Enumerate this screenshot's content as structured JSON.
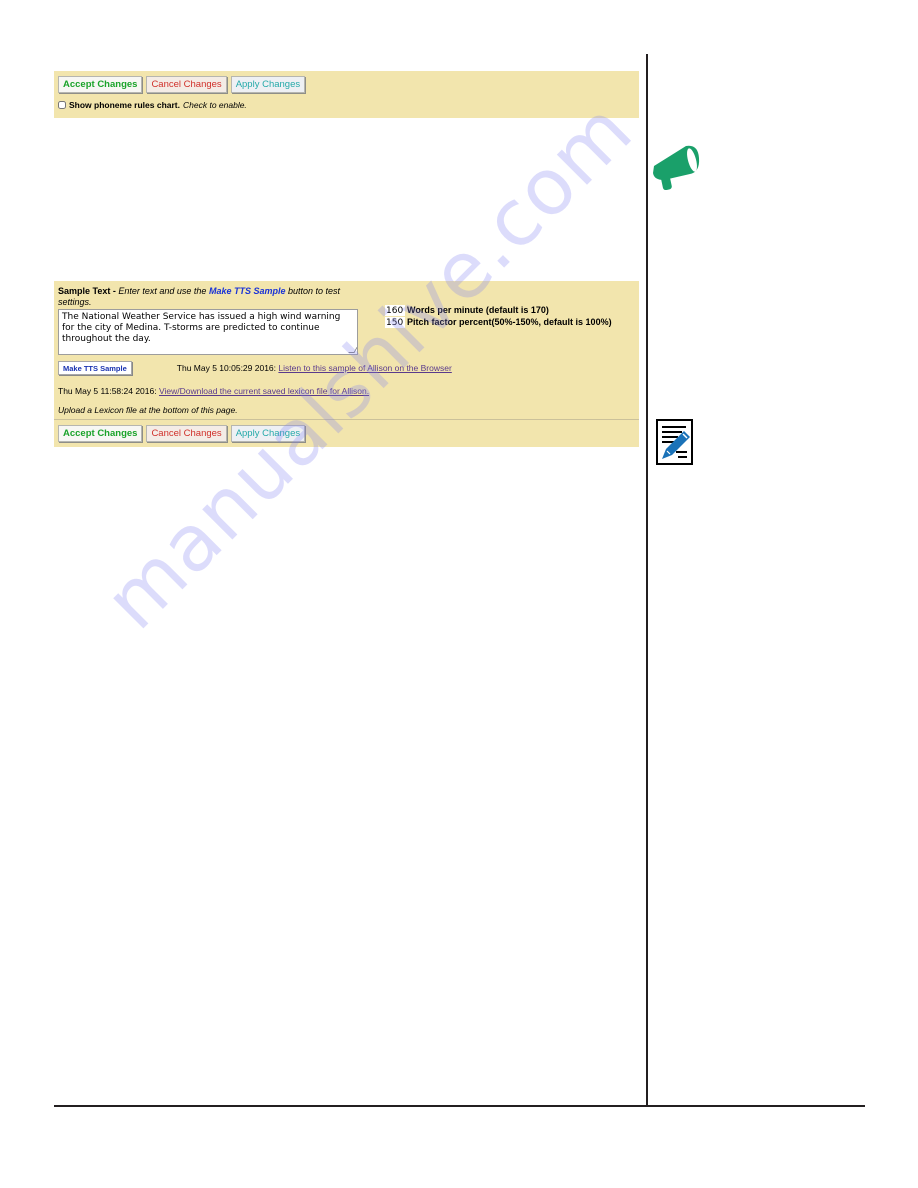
{
  "panel_top": {
    "buttons": {
      "accept": "Accept Changes",
      "cancel": "Cancel Changes",
      "apply": "Apply Changes"
    },
    "phoneme_checkbox": {
      "checked": false,
      "label_bold": "Show phoneme rules chart.",
      "label_italic": "Check to enable."
    }
  },
  "panel_sample": {
    "heading_bold": "Sample Text -",
    "heading_italic_pre": "Enter text and use the",
    "heading_highlight": "Make TTS Sample",
    "heading_italic_post": "button to test settings.",
    "sample_text": "The National Weather Service has issued a high wind warning for the city of Medina. T-storms are predicted to continue throughout the day.",
    "words_per_minute": {
      "value": "160",
      "label": "Words per minute (default is 170)"
    },
    "pitch_factor": {
      "value": "150",
      "label": "Pitch factor percent(50%-150%, default is 100%)"
    },
    "make_tts_button": "Make TTS Sample",
    "tts_timestamp": "Thu May 5 10:05:29 2016:",
    "tts_link": "Listen to this sample of Allison on the Browser",
    "lexicon_timestamp": "Thu May 5 11:58:24 2016:",
    "lexicon_link": "View/Download the current saved lexicon file for Allison.",
    "upload_note": "Upload a Lexicon file at the bottom of this page.",
    "buttons": {
      "accept": "Accept Changes",
      "cancel": "Cancel Changes",
      "apply": "Apply Changes"
    }
  },
  "sidebar_icons": {
    "megaphone": "megaphone-icon",
    "note": "note-pencil-icon",
    "megaphone_color": "#1aa06a",
    "note_color": "#1a72b8"
  },
  "colors": {
    "panel_bg": "#f2e5ad",
    "accept": "#1aa32a",
    "cancel": "#d0302a",
    "apply": "#25a9a9",
    "link": "#5a3a8c"
  },
  "watermark": "manualshive.com"
}
